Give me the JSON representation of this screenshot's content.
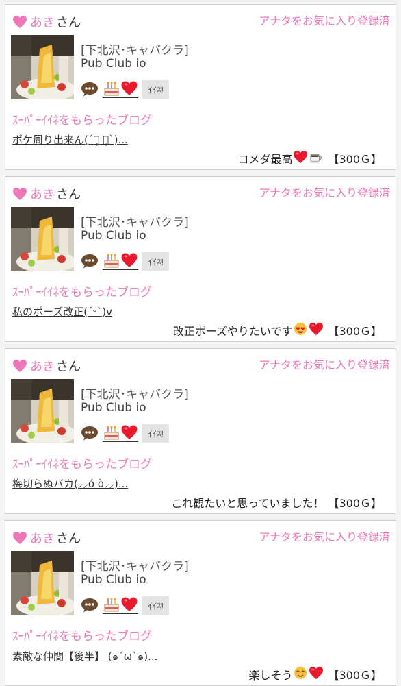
{
  "colors": {
    "accent_pink": "#ee77b8",
    "heart_red": "#e8192c"
  },
  "cards": [
    {
      "user_name": "あき",
      "user_suffix": "さん",
      "fav_label": "アナタをお気に入り登録済",
      "shop_type": "[下北沢･キャバクラ]",
      "shop_name": "Pub Club io",
      "iine_label": "ｲｲﾈ!",
      "blog_label": "ｽｰﾊﾟｰｲｲﾈをもらったブログ",
      "blog_title": "ポケ周り出来ん(´･̥̥̥ ･̥̥̥`)...",
      "comment_text": "コメダ最高",
      "comment_emojis": [
        "heart-icon",
        "coffee-icon"
      ],
      "points": "【300Ｇ】"
    },
    {
      "user_name": "あき",
      "user_suffix": "さん",
      "fav_label": "アナタをお気に入り登録済",
      "shop_type": "[下北沢･キャバクラ]",
      "shop_name": "Pub Club io",
      "iine_label": "ｲｲﾈ!",
      "blog_label": "ｽｰﾊﾟｰｲｲﾈをもらったブログ",
      "blog_title": "私のポーズ改正(´ᵕ`)v",
      "comment_text": "改正ポーズやりたいです",
      "comment_emojis": [
        "heart-eyes-icon",
        "heart-icon"
      ],
      "points": "【300Ｇ】"
    },
    {
      "user_name": "あき",
      "user_suffix": "さん",
      "fav_label": "アナタをお気に入り登録済",
      "shop_type": "[下北沢･キャバクラ]",
      "shop_name": "Pub Club io",
      "iine_label": "ｲｲﾈ!",
      "blog_label": "ｽｰﾊﾟｰｲｲﾈをもらったブログ",
      "blog_title": "梅切らぬバカ(⸝⸝ó ò⸝⸝)...",
      "comment_text": "これ観たいと思っていました！",
      "comment_emojis": [],
      "points": "【300Ｇ】"
    },
    {
      "user_name": "あき",
      "user_suffix": "さん",
      "fav_label": "アナタをお気に入り登録済",
      "shop_type": "[下北沢･キャバクラ]",
      "shop_name": "Pub Club io",
      "iine_label": "ｲｲﾈ!",
      "blog_label": "ｽｰﾊﾟｰｲｲﾈをもらったブログ",
      "blog_title": "素敵な仲間【後半】 (๑´ω`๑)...",
      "comment_text": "楽しそう",
      "comment_emojis": [
        "smiling-face-icon",
        "heart-icon"
      ],
      "points": "【300Ｇ】"
    }
  ]
}
